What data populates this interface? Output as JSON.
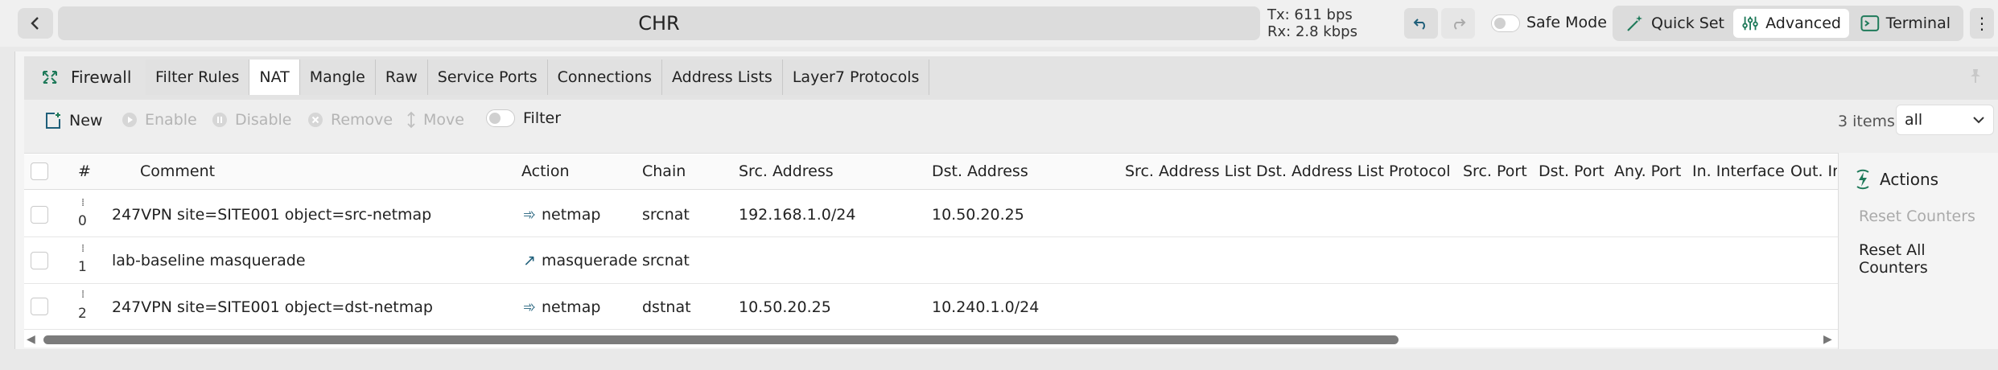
{
  "header": {
    "title": "CHR",
    "tx": "Tx: 611 bps",
    "rx": "Rx: 2.8 kbps",
    "safe_mode_label": "Safe Mode",
    "safe_mode_on": false,
    "quick_set_label": "Quick Set",
    "advanced_label": "Advanced",
    "terminal_label": "Terminal"
  },
  "section": {
    "title": "Firewall",
    "tabs": [
      "Filter Rules",
      "NAT",
      "Mangle",
      "Raw",
      "Service Ports",
      "Connections",
      "Address Lists",
      "Layer7 Protocols"
    ],
    "active_tab": "NAT"
  },
  "toolbar": {
    "new_label": "New",
    "enable_label": "Enable",
    "disable_label": "Disable",
    "remove_label": "Remove",
    "move_label": "Move",
    "filter_label": "Filter",
    "item_count": "3 items",
    "filter_select_value": "all"
  },
  "table": {
    "columns": [
      "#",
      "Comment",
      "Action",
      "Chain",
      "Src. Address",
      "Dst. Address",
      "Src. Address List",
      "Dst. Address List",
      "Protocol",
      "Src. Port",
      "Dst. Port",
      "Any. Port",
      "In. Interface",
      "Out. In"
    ],
    "rows": [
      {
        "num": "0",
        "comment": "247VPN site=SITE001 object=src-netmap",
        "action": "netmap",
        "chain": "srcnat",
        "src_address": "192.168.1.0/24",
        "dst_address": "10.50.20.25"
      },
      {
        "num": "1",
        "comment": "lab-baseline masquerade",
        "action": "masquerade",
        "chain": "srcnat",
        "src_address": "",
        "dst_address": ""
      },
      {
        "num": "2",
        "comment": "247VPN site=SITE001 object=dst-netmap",
        "action": "netmap",
        "chain": "dstnat",
        "src_address": "10.50.20.25",
        "dst_address": "10.240.1.0/24"
      }
    ]
  },
  "actions": {
    "title": "Actions",
    "reset_counters": "Reset Counters",
    "reset_all_counters": "Reset All Counters"
  },
  "colors": {
    "accent_green": "#1f7a5a",
    "disabled_text": "#b4b4b4"
  },
  "icons": {
    "back": "chevron-left-icon",
    "undo": "undo-icon",
    "redo": "redo-icon",
    "quick_set": "magic-wand-icon",
    "advanced": "sliders-icon",
    "terminal": "terminal-icon",
    "firewall": "firewall-icon",
    "new": "add-document-icon",
    "actions": "lightning-icon"
  }
}
